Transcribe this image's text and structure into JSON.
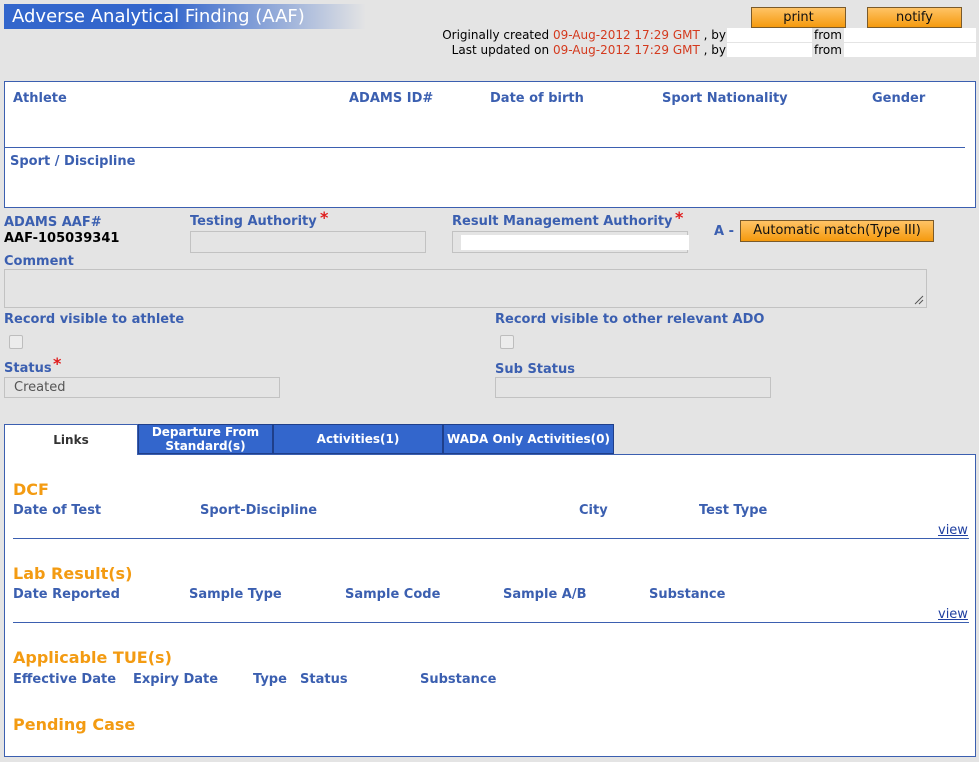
{
  "header": {
    "title": "Adverse Analytical Finding (AAF)",
    "print_label": "print",
    "notify_label": "notify",
    "created_prefix": "Originally created",
    "created_date": "09-Aug-2012 17:29 GMT",
    "updated_prefix": "Last updated on",
    "updated_date": "09-Aug-2012 17:29 GMT",
    "by_text": ", by",
    "from_text": "from"
  },
  "athlete_box": {
    "athlete": "Athlete",
    "adams_id": "ADAMS ID#",
    "dob": "Date of birth",
    "sport_nationality": "Sport Nationality",
    "gender": "Gender",
    "sport_discipline": "Sport / Discipline"
  },
  "details": {
    "aaf_label": "ADAMS AAF#",
    "aaf_value": "AAF-105039341",
    "testing_authority": "Testing Authority",
    "rma": "Result Management Authority",
    "a_prefix": "A -",
    "auto_match": "Automatic match(Type III)",
    "comment": "Comment",
    "visible_athlete": "Record visible to athlete",
    "visible_ado": "Record visible to other relevant ADO",
    "status": "Status",
    "status_value": "Created",
    "sub_status": "Sub Status",
    "required_mark": "*"
  },
  "tabs": [
    {
      "label": "Links"
    },
    {
      "label": "Departure From Standard(s)"
    },
    {
      "label": "Activities(1)"
    },
    {
      "label": "WADA Only Activities(0)"
    }
  ],
  "links": {
    "dcf": {
      "title": "DCF",
      "columns": [
        "Date of Test",
        "Sport-Discipline",
        "City",
        "Test Type"
      ],
      "view": "view"
    },
    "lab": {
      "title": "Lab Result(s)",
      "columns": [
        "Date Reported",
        "Sample Type",
        "Sample Code",
        "Sample A/B",
        "Substance"
      ],
      "view": "view"
    },
    "tue": {
      "title": "Applicable TUE(s)",
      "columns": [
        "Effective Date",
        "Expiry Date",
        "Type",
        "Status",
        "Substance"
      ]
    },
    "pending": {
      "title": "Pending Case"
    }
  },
  "colors": {
    "accent_blue": "#3366cc",
    "label_blue": "#3b5fb0",
    "orange": "#f39b12",
    "date_red": "#d43a1e"
  }
}
